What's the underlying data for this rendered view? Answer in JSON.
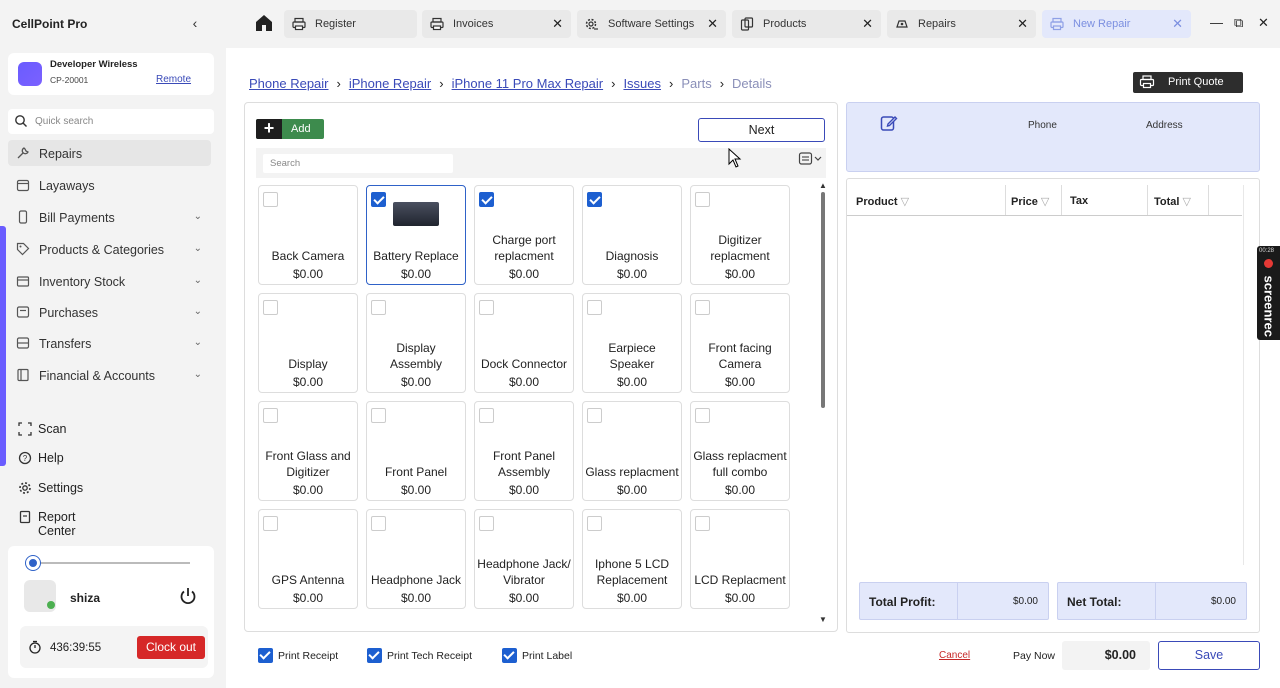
{
  "sidebar": {
    "brand": "CellPoint Pro",
    "collapse": "‹",
    "store": {
      "name": "Developer Wireless",
      "code": "CP-20001",
      "remote": "Remote"
    },
    "quick_search_placeholder": "Quick search",
    "nav": [
      {
        "label": "Repairs",
        "icon": "wrench-icon",
        "active": true
      },
      {
        "label": "Layaways",
        "icon": "calendar-icon"
      },
      {
        "label": "Bill Payments",
        "icon": "phone-icon",
        "chevron": "⌄"
      },
      {
        "label": "Products & Categories",
        "icon": "tag-icon",
        "chevron": "⌄"
      },
      {
        "label": "Inventory Stock",
        "icon": "box-icon",
        "chevron": "⌄"
      },
      {
        "label": "Purchases",
        "icon": "cart-icon",
        "chevron": "⌄"
      },
      {
        "label": "Transfers",
        "icon": "transfer-icon",
        "chevron": "⌄"
      },
      {
        "label": "Financial & Accounts",
        "icon": "ledger-icon",
        "chevron": "⌄"
      }
    ],
    "bottom_nav": [
      "Scan",
      "Help",
      "Settings",
      "Report Center"
    ],
    "user": {
      "name": "shiza",
      "timer": "436:39:55",
      "clock_out": "Clock out"
    }
  },
  "tabs": [
    {
      "label": "Register",
      "icon": "printer-icon",
      "closable": false
    },
    {
      "label": "Invoices",
      "icon": "printer-icon",
      "closable": true
    },
    {
      "label": "Software Settings",
      "icon": "gear-icon",
      "closable": true
    },
    {
      "label": "Products",
      "icon": "products-icon",
      "closable": true
    },
    {
      "label": "Repairs",
      "icon": "repair-icon",
      "closable": true
    },
    {
      "label": "New Repair",
      "icon": "printer-icon",
      "closable": true,
      "active": true
    }
  ],
  "close_glyph": "✕",
  "window_controls": {
    "minimize": "—",
    "restore": "⧉",
    "close": "✕"
  },
  "breadcrumbs": [
    {
      "label": "Phone Repair",
      "state": "link"
    },
    {
      "label": "iPhone Repair",
      "state": "link"
    },
    {
      "label": "iPhone 11 Pro Max Repair",
      "state": "link"
    },
    {
      "label": "Issues",
      "state": "link"
    },
    {
      "label": "Parts",
      "state": "dim"
    },
    {
      "label": "Details",
      "state": "dim"
    }
  ],
  "crumb_sep": "›",
  "print_quote": "Print Quote",
  "toolbar": {
    "add": "Add",
    "next": "Next",
    "search_placeholder": "Search"
  },
  "items": [
    {
      "name": "Back Camera",
      "price": "$0.00",
      "checked": false
    },
    {
      "name": "Battery Replace",
      "price": "$0.00",
      "checked": true,
      "thumb": true
    },
    {
      "name": "Charge port replacment",
      "price": "$0.00",
      "checked": true
    },
    {
      "name": "Diagnosis",
      "price": "$0.00",
      "checked": true
    },
    {
      "name": "Digitizer replacment",
      "price": "$0.00",
      "checked": false
    },
    {
      "name": "Display",
      "price": "$0.00",
      "checked": false
    },
    {
      "name": "Display Assembly",
      "price": "$0.00",
      "checked": false
    },
    {
      "name": "Dock Connector",
      "price": "$0.00",
      "checked": false
    },
    {
      "name": "Earpiece Speaker",
      "price": "$0.00",
      "checked": false
    },
    {
      "name": "Front facing Camera",
      "price": "$0.00",
      "checked": false
    },
    {
      "name": "Front Glass and Digitizer",
      "price": "$0.00",
      "checked": false
    },
    {
      "name": "Front Panel",
      "price": "$0.00",
      "checked": false
    },
    {
      "name": "Front Panel Assembly",
      "price": "$0.00",
      "checked": false
    },
    {
      "name": "Glass replacment",
      "price": "$0.00",
      "checked": false
    },
    {
      "name": "Glass replacment full combo",
      "price": "$0.00",
      "checked": false
    },
    {
      "name": "GPS Antenna",
      "price": "$0.00",
      "checked": false
    },
    {
      "name": "Headphone Jack",
      "price": "$0.00",
      "checked": false
    },
    {
      "name": "Headphone Jack/ Vibrator",
      "price": "$0.00",
      "checked": false
    },
    {
      "name": "Iphone 5 LCD Replacement",
      "price": "$0.00",
      "checked": false
    },
    {
      "name": "LCD Replacment",
      "price": "$0.00",
      "checked": false
    }
  ],
  "customer": {
    "phone": "Phone",
    "address": "Address"
  },
  "cart_table": {
    "columns": [
      "Product",
      "Price",
      "Tax",
      "Total"
    ],
    "filter_glyph": "▽"
  },
  "totals": {
    "profit_label": "Total Profit:",
    "profit_value": "$0.00",
    "net_label": "Net Total:",
    "net_value": "$0.00"
  },
  "footer": {
    "print_receipt": "Print Receipt",
    "print_tech_receipt": "Print Tech Receipt",
    "print_label": "Print Label",
    "cancel": "Cancel",
    "pay_now": "Pay Now",
    "pay_now_value": "$0.00",
    "save": "Save"
  },
  "recorder": {
    "time": "00:28",
    "brand": "screenrec"
  },
  "colors": {
    "accent": "#3a4ab8",
    "active_tab": "#e3e8fb",
    "add_green": "#3d8b4d",
    "clock_out": "#d62828",
    "check": "#1d5fd0"
  }
}
